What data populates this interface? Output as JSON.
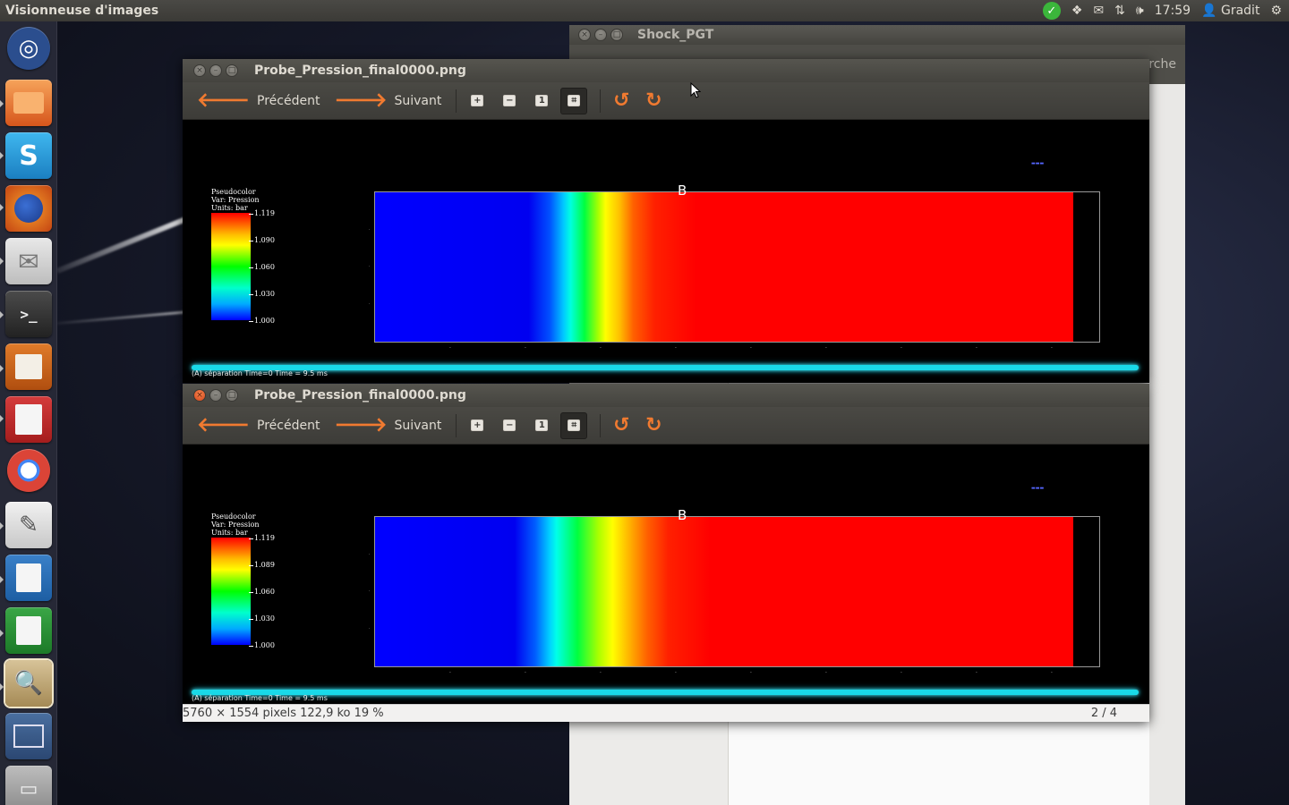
{
  "top_panel": {
    "app_title": "Visionneuse d'images",
    "time": "17:59",
    "user": "Gradit"
  },
  "background_window": {
    "title": "Shock_PGT",
    "search_hint": "rche"
  },
  "viewer": {
    "title": "Probe_Pression_final0000.png",
    "prev_label": "Précédent",
    "next_label": "Suivant",
    "status_info": "5760 × 1554 pixels  122,9 ko    19 %",
    "status_page": "2 / 4"
  },
  "plot_top": {
    "legend_title": "Pseudocolor",
    "legend_var": "Var: Pression",
    "legend_units": "Units: bar",
    "ticks": [
      "1.119",
      "1.090",
      "1.060",
      "1.030",
      "1.000"
    ],
    "label": "B",
    "footnote": "(A) séparation  Time=0  Time = 9.5 ms"
  },
  "plot_bottom": {
    "legend_title": "Pseudocolor",
    "legend_var": "Var: Pression",
    "legend_units": "Units: bar",
    "ticks": [
      "1.119",
      "1.089",
      "1.060",
      "1.030",
      "1.000"
    ],
    "label": "B",
    "footnote": "(A) séparation  Time=0  Time = 9.5 ms"
  },
  "icons": {
    "check": "check-icon",
    "dropbox": "dropbox-icon",
    "mail": "mail-icon",
    "network": "network-icon",
    "volume": "volume-icon",
    "user": "user-icon",
    "gear": "gear-icon"
  },
  "colors": {
    "accent_orange": "#f07a30",
    "panel": "#3c3b37",
    "glow": "#19d9e8"
  }
}
